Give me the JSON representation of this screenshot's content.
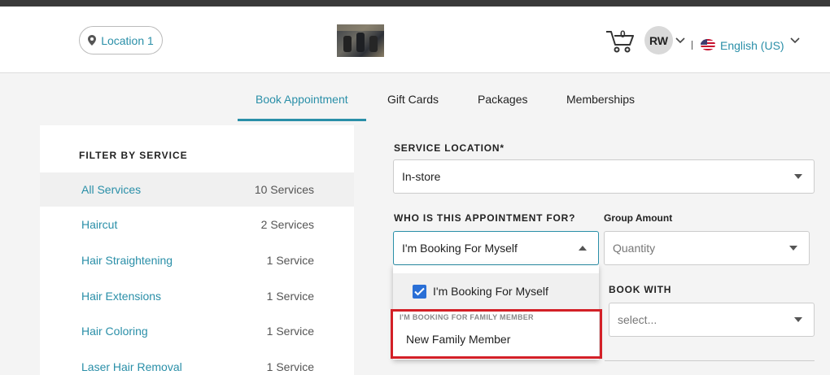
{
  "header": {
    "location_label": "Location 1",
    "cart_count": "0",
    "user_initials": "RW",
    "language": "English (US)"
  },
  "tabs": [
    {
      "label": "Book Appointment",
      "active": true
    },
    {
      "label": "Gift Cards",
      "active": false
    },
    {
      "label": "Packages",
      "active": false
    },
    {
      "label": "Memberships",
      "active": false
    }
  ],
  "sidebar": {
    "title": "FILTER BY SERVICE",
    "items": [
      {
        "name": "All Services",
        "count": "10 Services",
        "active": true
      },
      {
        "name": "Haircut",
        "count": "2 Services"
      },
      {
        "name": "Hair Straightening",
        "count": "1 Service"
      },
      {
        "name": "Hair Extensions",
        "count": "1 Service"
      },
      {
        "name": "Hair Coloring",
        "count": "1 Service"
      },
      {
        "name": "Laser Hair Removal",
        "count": "1 Service"
      }
    ]
  },
  "form": {
    "service_location_label": "SERVICE LOCATION*",
    "service_location_value": "In-store",
    "appointment_for_label": "WHO IS THIS APPOINTMENT FOR?",
    "appointment_for_value": "I'm Booking For Myself",
    "group_amount_label": "Group Amount",
    "group_amount_placeholder": "Quantity",
    "book_with_label": "BOOK WITH",
    "book_with_placeholder": "select..."
  },
  "dropdown": {
    "option_selected": "I'm Booking For Myself",
    "group_label": "I'M BOOKING FOR FAMILY MEMBER",
    "option_family": "New Family Member"
  },
  "colors": {
    "accent": "#2a8fa8",
    "checkbox": "#2a6fd6",
    "highlight": "#d32027"
  }
}
